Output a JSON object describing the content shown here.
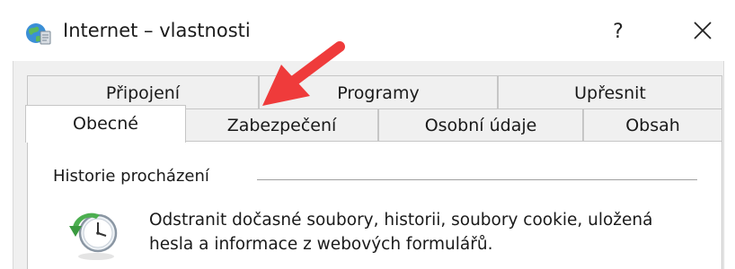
{
  "window": {
    "title": "Internet – vlastnosti",
    "help_label": "?",
    "close_icon": "close-icon",
    "app_icon": "internet-options-globe-icon"
  },
  "tabs": {
    "row1": [
      {
        "label": "Připojení"
      },
      {
        "label": "Programy"
      },
      {
        "label": "Upřesnit"
      }
    ],
    "row2": [
      {
        "label": "Obecné",
        "active": true
      },
      {
        "label": "Zabezpečení"
      },
      {
        "label": "Osobní údaje"
      },
      {
        "label": "Obsah"
      }
    ]
  },
  "general": {
    "history_group_label": "Historie procházení",
    "history_description_line1": "Odstranit dočasné soubory, historii, soubory cookie, uložená",
    "history_description_line2": "hesla a informace z webových formulářů.",
    "history_icon": "clock-history-icon"
  },
  "annotation": {
    "arrow_color": "#ef3b3b",
    "arrow_icon": "annotation-arrow-icon"
  }
}
